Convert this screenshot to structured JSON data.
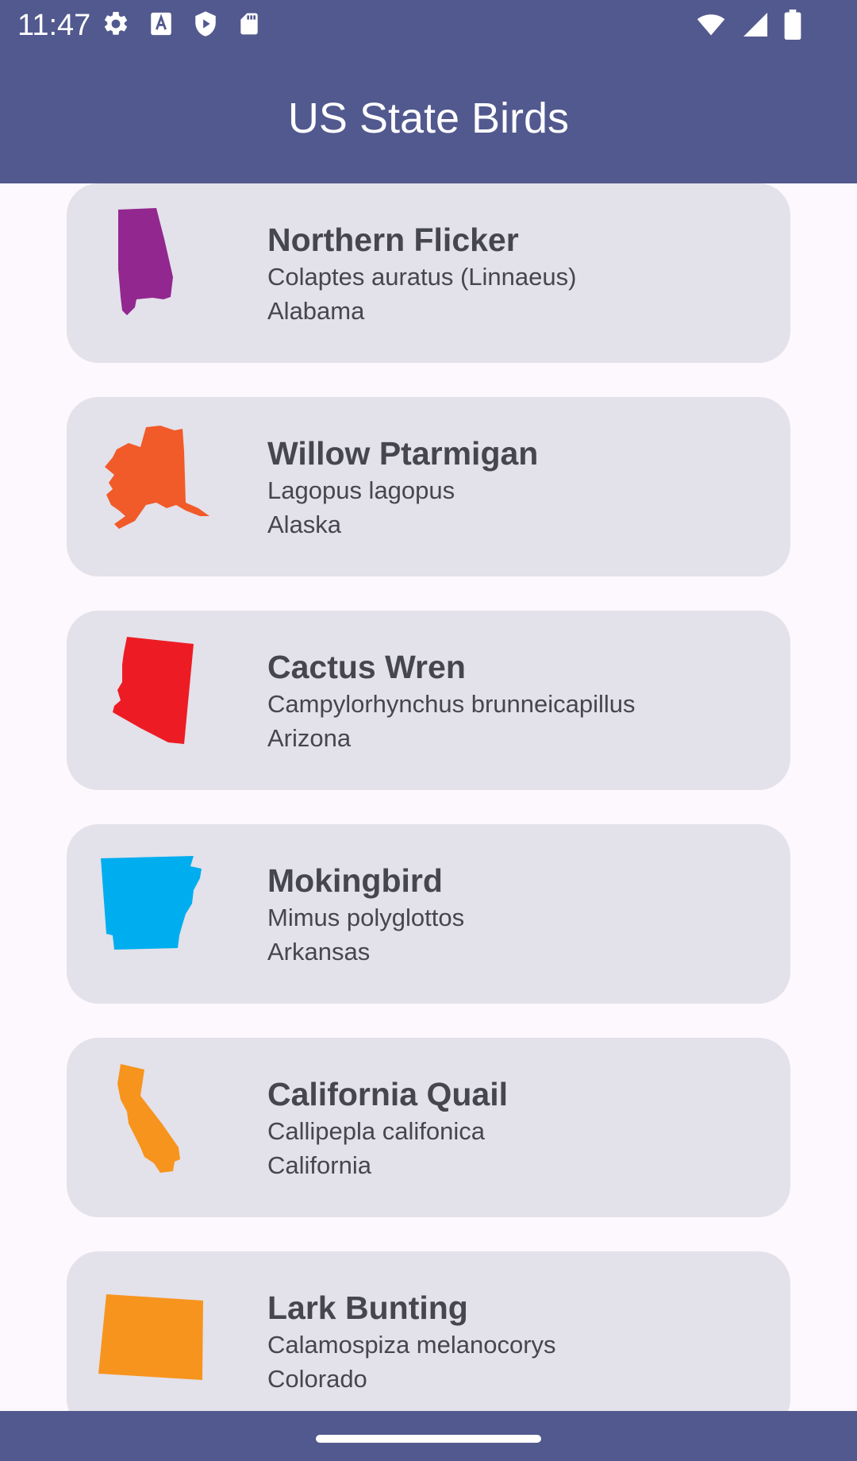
{
  "status_bar": {
    "time": "11:47",
    "left_icons": [
      "settings-icon",
      "font-a-icon",
      "play-protect-icon",
      "sd-card-icon"
    ],
    "right_icons": [
      "wifi-icon",
      "cell-signal-icon",
      "battery-icon"
    ]
  },
  "app_bar": {
    "title": "US State Birds",
    "background": "#52598e"
  },
  "birds": [
    {
      "name": "Northern Flicker",
      "scientific": "Colaptes auratus (Linnaeus)",
      "state": "Alabama",
      "map_icon": "alabama-map-icon",
      "color": "#92278f"
    },
    {
      "name": "Willow Ptarmigan",
      "scientific": "Lagopus lagopus",
      "state": "Alaska",
      "map_icon": "alaska-map-icon",
      "color": "#f15a29"
    },
    {
      "name": "Cactus Wren",
      "scientific": "Campylorhynchus brunneicapillus",
      "state": "Arizona",
      "map_icon": "arizona-map-icon",
      "color": "#ed1c24"
    },
    {
      "name": "Mokingbird",
      "scientific": "Mimus polyglottos",
      "state": "Arkansas",
      "map_icon": "arkansas-map-icon",
      "color": "#00aeef"
    },
    {
      "name": "California Quail",
      "scientific": "Callipepla califonica",
      "state": "California",
      "map_icon": "california-map-icon",
      "color": "#f7941d"
    },
    {
      "name": "Lark Bunting",
      "scientific": "Calamospiza melanocorys",
      "state": "Colorado",
      "map_icon": "colorado-map-icon",
      "color": "#f7941d"
    }
  ],
  "colors": {
    "card_background": "#e3e1ea",
    "page_background": "#fdf8fd",
    "text": "#46464f"
  }
}
